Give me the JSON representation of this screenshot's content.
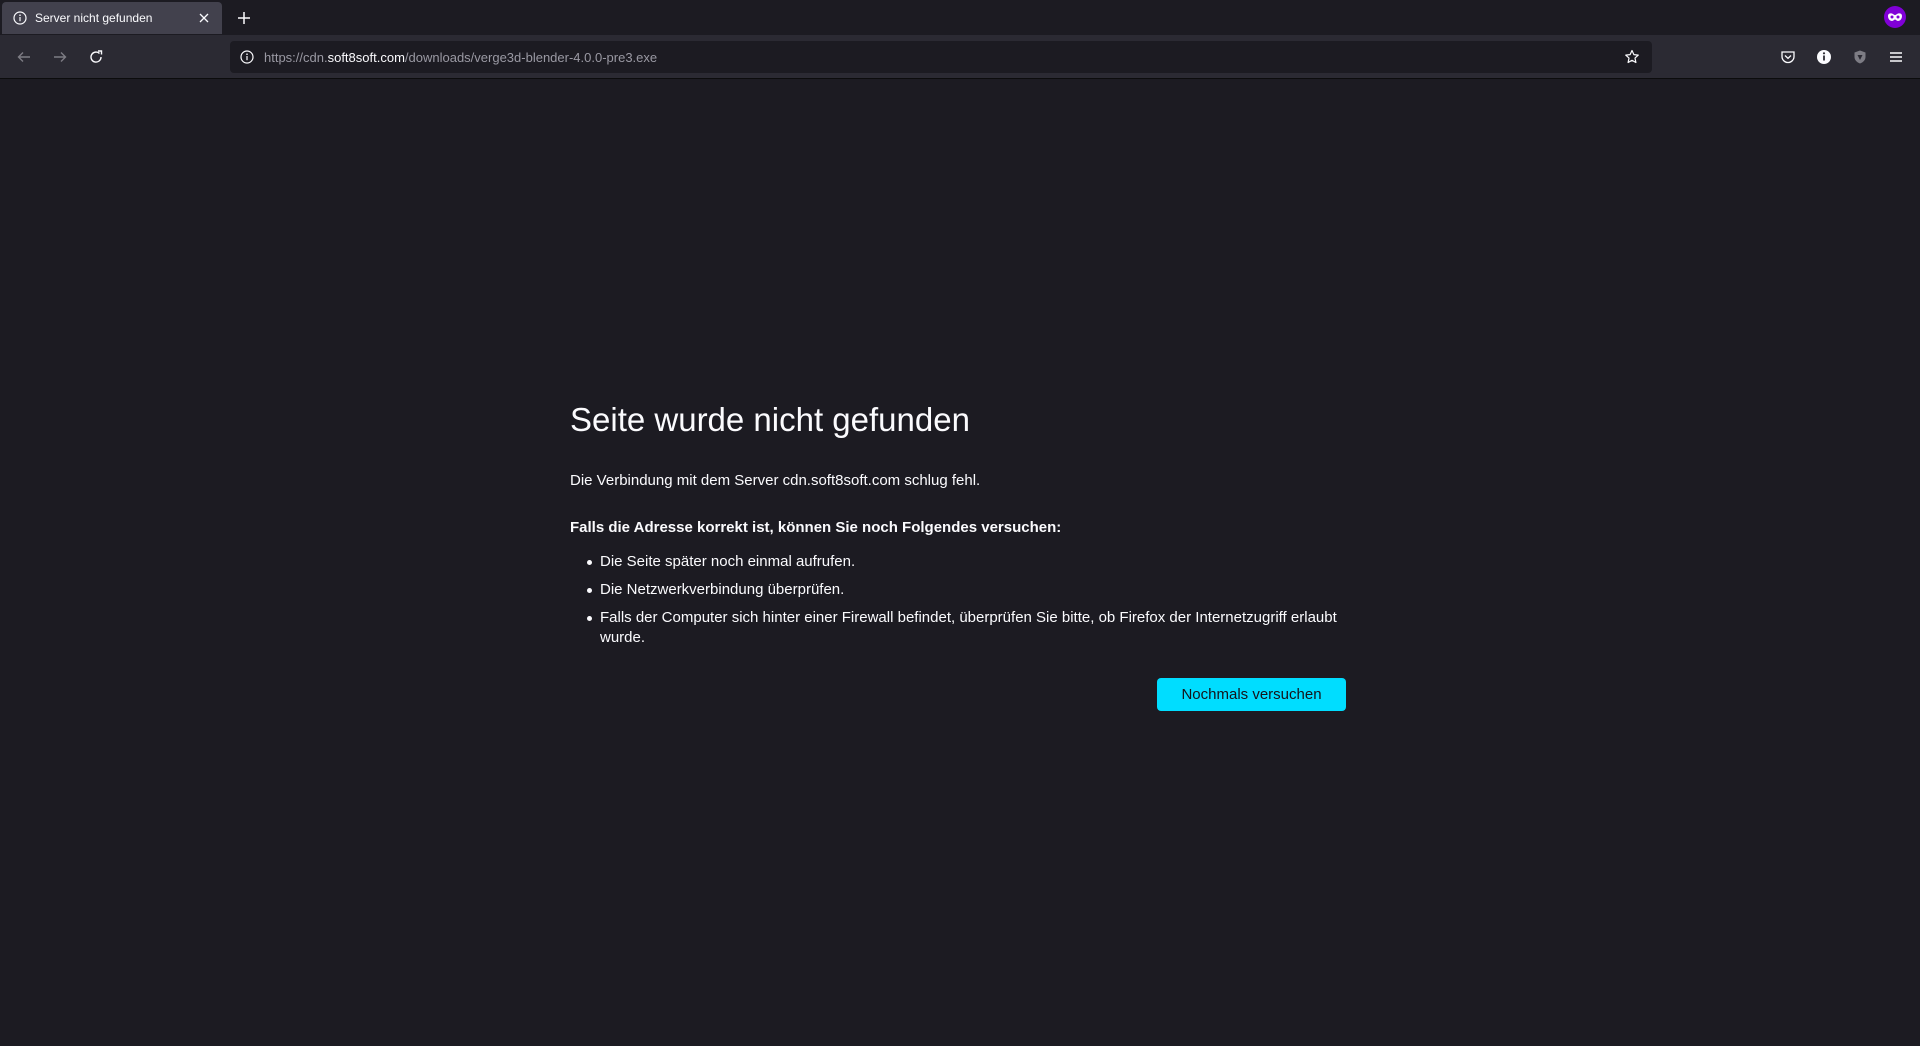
{
  "tab": {
    "title": "Server nicht gefunden",
    "icon": "info-icon"
  },
  "navbar": {
    "url_prefix": "https://cdn.",
    "url_host": "soft8soft.com",
    "url_path": "/downloads/verge3d-blender-4.0.0-pre3.exe"
  },
  "error": {
    "title": "Seite wurde nicht gefunden",
    "description": "Die Verbindung mit dem Server cdn.soft8soft.com schlug fehl.",
    "suggestions_heading": "Falls die Adresse korrekt ist, können Sie noch Folgendes versuchen:",
    "suggestions": [
      "Die Seite später noch einmal aufrufen.",
      "Die Netzwerkverbindung überprüfen.",
      "Falls der Computer sich hinter einer Firewall befindet, überprüfen Sie bitte, ob Firefox der Internetzugriff erlaubt wurde."
    ],
    "retry_label": "Nochmals versuchen"
  },
  "colors": {
    "background": "#1c1b22",
    "toolbar": "#2b2a33",
    "accent": "#00ddff",
    "private": "#8000d7"
  }
}
